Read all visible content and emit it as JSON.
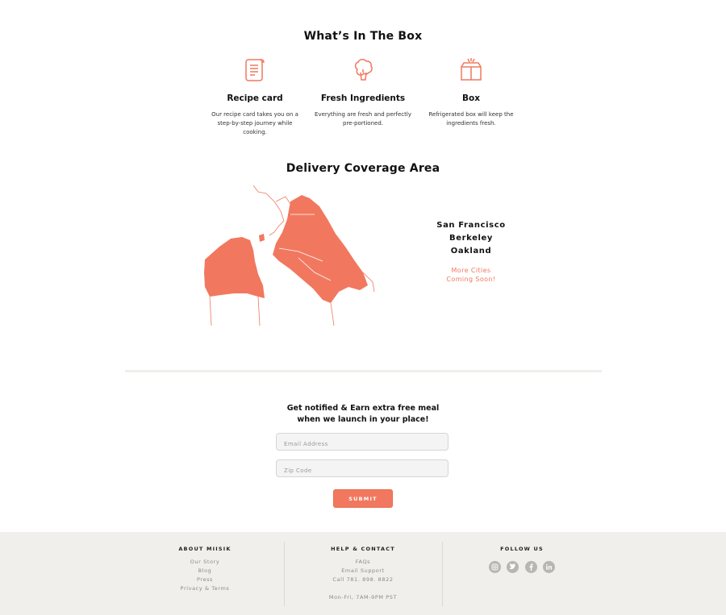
{
  "box_section": {
    "title": "What’s In The Box",
    "features": [
      {
        "icon": "recipe-card-icon",
        "title": "Recipe card",
        "desc": "Our recipe card takes you on a step-by-step journey while cooking."
      },
      {
        "icon": "broccoli-icon",
        "title": "Fresh Ingredients",
        "desc": "Everything are fresh and perfectly pre-portioned."
      },
      {
        "icon": "box-icon",
        "title": "Box",
        "desc": "Refrigerated box will keep the ingredients fresh."
      }
    ]
  },
  "coverage": {
    "title": "Delivery Coverage Area",
    "cities": [
      "San Francisco",
      "Berkeley",
      "Oakland"
    ],
    "more_line1": "More Cities",
    "more_line2": "Coming Soon!"
  },
  "signup": {
    "line1": "Get notified & Earn extra free meal",
    "line2": "when we launch in your place!",
    "email_placeholder": "Email Address",
    "zip_placeholder": "Zip Code",
    "submit_label": "SUBMIT"
  },
  "footer": {
    "about": {
      "heading": "ABOUT MIISIK",
      "links": [
        "Our Story",
        "Blog",
        "Press",
        "Privacy & Terms"
      ]
    },
    "help": {
      "heading": "HELP & CONTACT",
      "links": [
        "FAQs",
        "Email Support",
        "Call 781. 898. 8822"
      ],
      "hours": "Mon-Fri, 7AM-9PM PST"
    },
    "follow": {
      "heading": "FOLLOW US",
      "icons": [
        "instagram-icon",
        "twitter-icon",
        "facebook-icon",
        "linkedin-icon"
      ]
    }
  },
  "colors": {
    "accent": "#f1785f",
    "footer_bg": "#f0efeb",
    "social_icon": "#b7b6b1"
  }
}
